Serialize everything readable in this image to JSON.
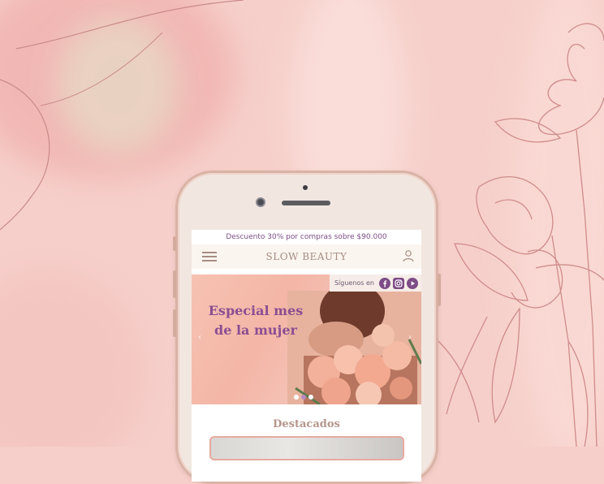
{
  "promo": {
    "text": "Descuento 30% por compras sobre $90.000"
  },
  "header": {
    "brand": "SLOW BEAUTY"
  },
  "hero": {
    "social_label": "Síguenos en",
    "title": "Especial mes de la mujer",
    "slides_total": 3,
    "slide_active": 2
  },
  "featured": {
    "title": "Destacados"
  },
  "icons": [
    "menu-icon",
    "user-icon",
    "facebook-icon",
    "instagram-icon",
    "youtube-icon",
    "chevron-left-icon",
    "chevron-right-icon"
  ],
  "colors": {
    "accent": "#7d4c86",
    "hero_title": "#8b4e92",
    "brand": "#a58d83",
    "background": "#f6cfca"
  }
}
